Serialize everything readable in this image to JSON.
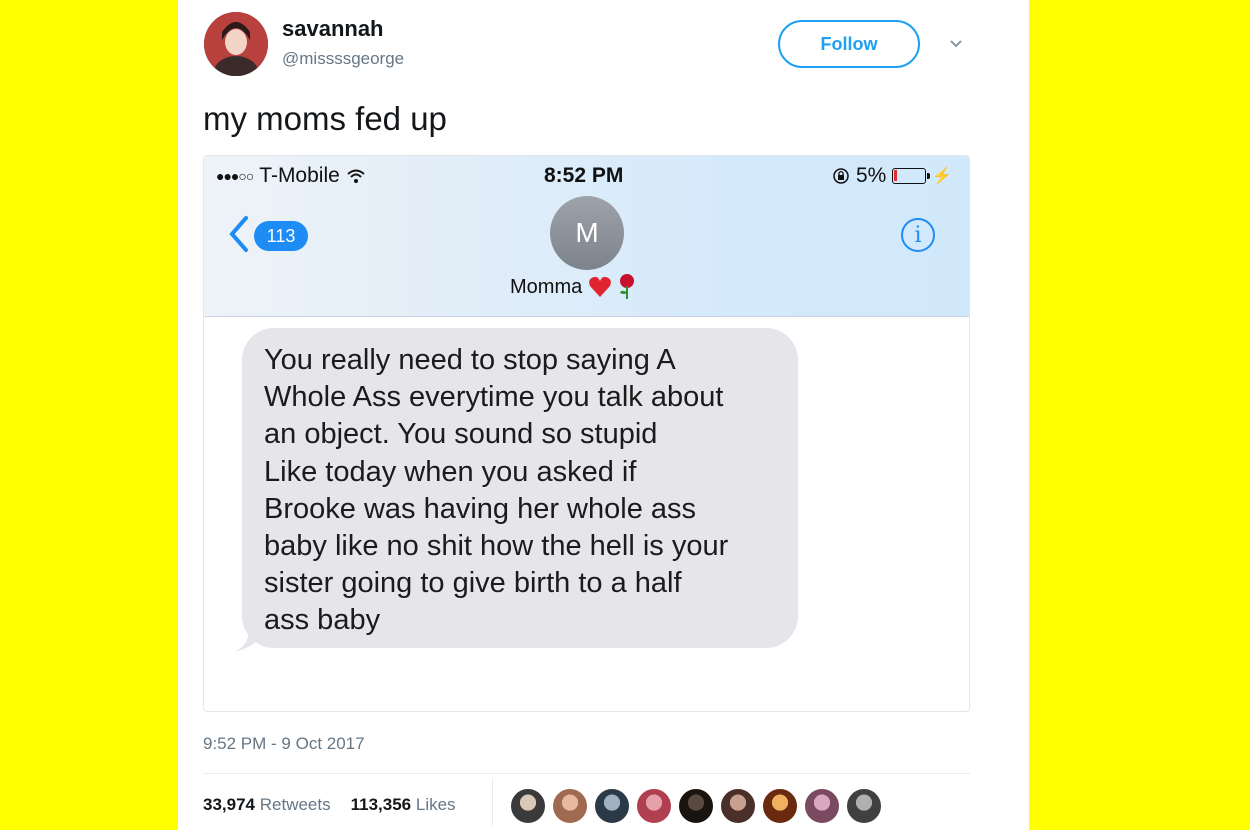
{
  "tweet": {
    "display_name": "savannah",
    "handle": "@missssgeorge",
    "follow_label": "Follow",
    "text": "my moms fed up",
    "timestamp": "9:52 PM - 9 Oct 2017",
    "retweets_count": "33,974",
    "retweets_label": "Retweets",
    "likes_count": "113,356",
    "likes_label": "Likes"
  },
  "screenshot": {
    "carrier": "T-Mobile",
    "time": "8:52 PM",
    "battery": "5%",
    "back_count": "113",
    "contact_initial": "M",
    "contact_name": "Momma",
    "message_lines": [
      "You really need to stop saying A",
      "Whole Ass everytime you talk about",
      "an object. You sound so stupid",
      "Like today when you asked if",
      "Brooke was having her whole ass",
      "baby like no shit how the hell is your",
      "sister going to give birth to a half",
      "ass baby"
    ]
  },
  "colors": {
    "background": "#ffff00",
    "twitter_blue": "#1da1f2",
    "imessage_blue": "#1e8cf5",
    "bubble_gray": "#e5e5ea"
  },
  "icons": [
    "chevron-down-icon",
    "wifi-icon",
    "battery-icon",
    "back-chevron-icon",
    "info-icon",
    "heart-emoji-icon",
    "rose-emoji-icon"
  ]
}
